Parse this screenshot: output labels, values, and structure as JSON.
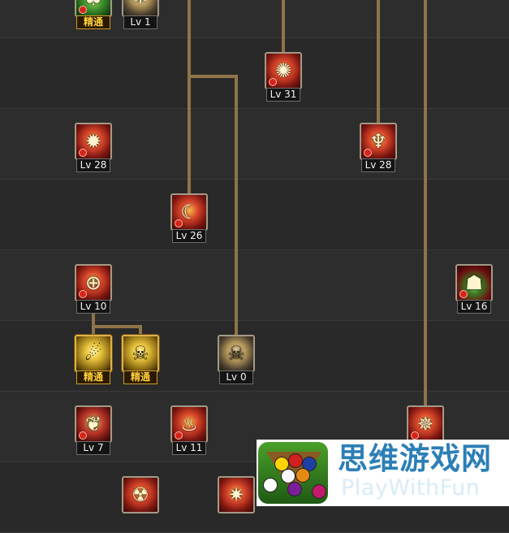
{
  "skills": [
    {
      "id": "s1",
      "level": "精通",
      "variant": "green"
    },
    {
      "id": "s2",
      "level": "Lv 1",
      "variant": "grey"
    },
    {
      "id": "s3",
      "level": "Lv 31",
      "variant": "red"
    },
    {
      "id": "s4",
      "level": "Lv 28",
      "variant": "red"
    },
    {
      "id": "s5",
      "level": "Lv 28",
      "variant": "red"
    },
    {
      "id": "s6",
      "level": "Lv 26",
      "variant": "red"
    },
    {
      "id": "s7",
      "level": "Lv 10",
      "variant": "red"
    },
    {
      "id": "s8",
      "level": "Lv 16",
      "variant": "green"
    },
    {
      "id": "s9",
      "level": "精通",
      "variant": "elite"
    },
    {
      "id": "s10",
      "level": "精通",
      "variant": "elite"
    },
    {
      "id": "s11",
      "level": "Lv 0",
      "variant": "grey"
    },
    {
      "id": "s12",
      "level": "Lv 7",
      "variant": "red"
    },
    {
      "id": "s13",
      "level": "Lv 11",
      "variant": "red"
    }
  ],
  "watermark": {
    "title_cn": "思维游戏网",
    "title_en": "PlayWithFun"
  }
}
